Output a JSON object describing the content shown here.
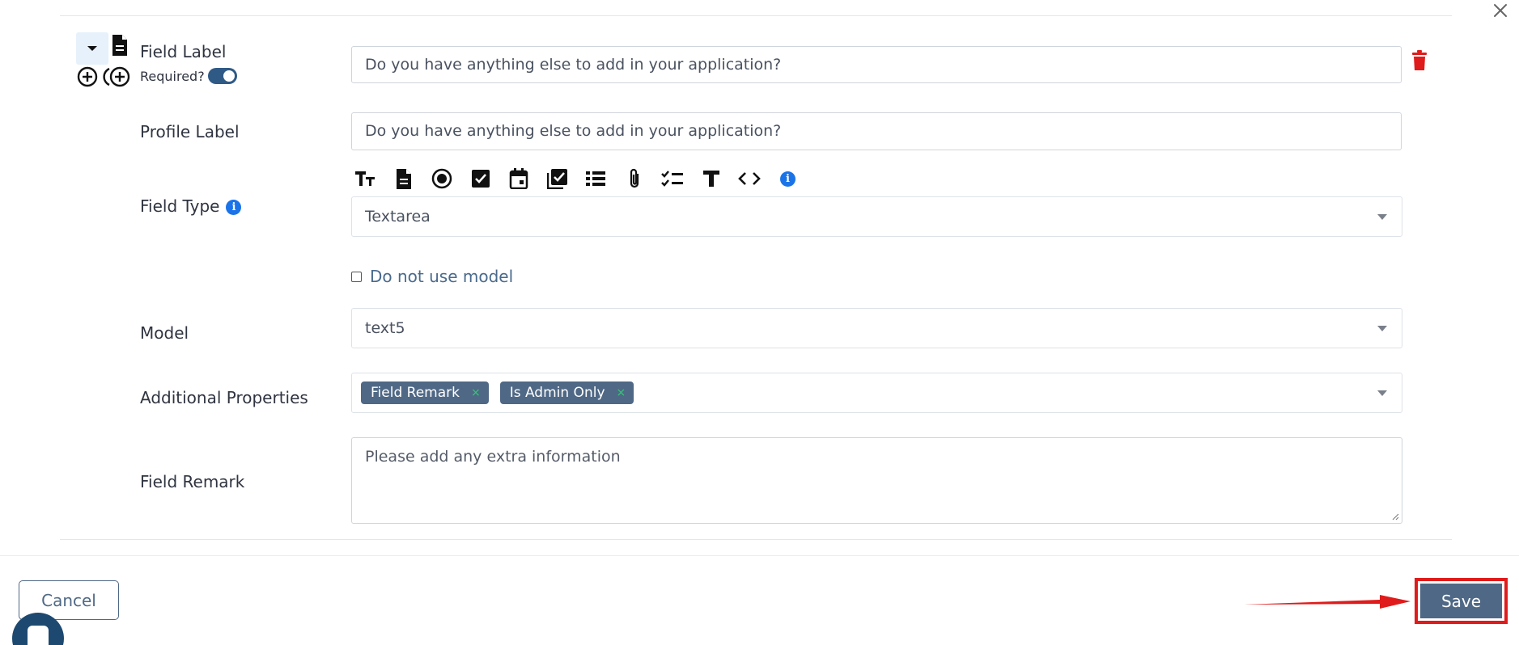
{
  "field": {
    "field_label": "Field Label",
    "required_label": "Required?",
    "required_on": true,
    "field_label_value": "Do you have anything else to add in your application?",
    "profile_label": "Profile Label",
    "profile_label_value": "Do you have anything else to add in your application?",
    "field_type_label": "Field Type",
    "field_type_value": "Textarea",
    "do_not_use_model_label": "Do not use model",
    "model_label": "Model",
    "model_value": "text5",
    "additional_properties_label": "Additional Properties",
    "additional_properties": [
      {
        "label": "Field Remark",
        "remove": "×"
      },
      {
        "label": "Is Admin Only",
        "remove": "×"
      }
    ],
    "field_remark_label": "Field Remark",
    "field_remark_placeholder": "Please add any extra information"
  },
  "toolbar_icons": [
    "text-size-icon",
    "document-icon",
    "radio-icon",
    "checkbox-icon",
    "calendar-icon",
    "checklist-icon",
    "list-icon",
    "attachment-icon",
    "task-list-icon",
    "text-icon",
    "code-icon",
    "info-icon"
  ],
  "footer": {
    "cancel_label": "Cancel",
    "save_label": "Save"
  },
  "info_glyph": "i",
  "colors": {
    "primary": "#4f6885",
    "toggle": "#2f5a86",
    "highlight": "#e01b1b",
    "trash": "#e01b1b",
    "info": "#1a73e8"
  }
}
